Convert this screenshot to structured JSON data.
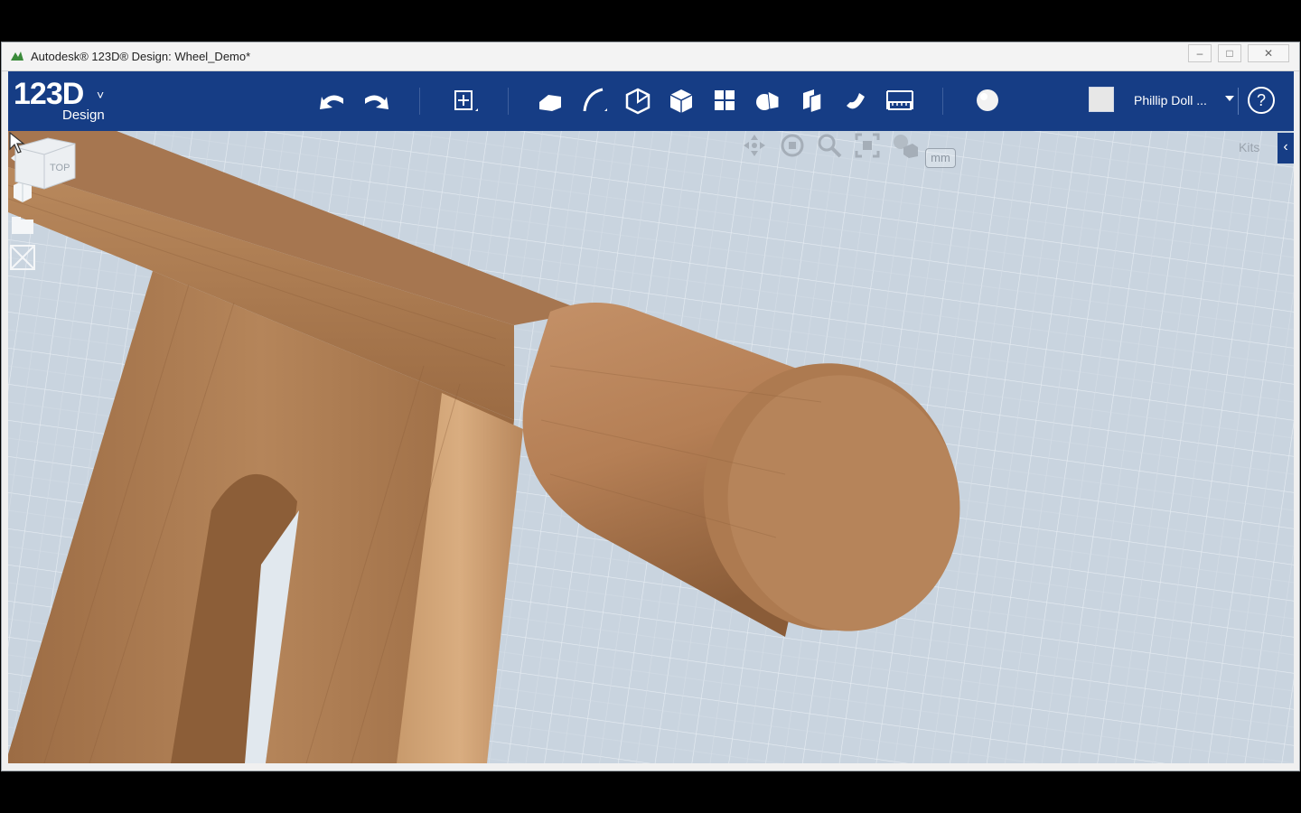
{
  "window": {
    "title": "Autodesk® 123D® Design: Wheel_Demo*",
    "controls": {
      "minimize": "–",
      "maximize": "□",
      "close": "✕"
    }
  },
  "toolbar": {
    "logo_main": "123D",
    "logo_sub": "Design",
    "logo_caret": "˅",
    "tools": [
      {
        "name": "undo-icon"
      },
      {
        "name": "redo-icon"
      },
      {
        "name": "transform-icon"
      },
      {
        "name": "primitives-icon"
      },
      {
        "name": "sketch-icon"
      },
      {
        "name": "construct-icon"
      },
      {
        "name": "modify-icon"
      },
      {
        "name": "pattern-icon"
      },
      {
        "name": "grouping-icon"
      },
      {
        "name": "combine-icon"
      },
      {
        "name": "snap-icon"
      },
      {
        "name": "measure-icon"
      },
      {
        "name": "material-icon"
      }
    ],
    "user": {
      "name": "Phillip Doll ..."
    },
    "help_label": "?"
  },
  "viewport": {
    "kits_label": "Kits",
    "kits_toggle": "‹",
    "units_label": "mm",
    "viewcube_label": "TOP",
    "nav_icons": [
      "pan-icon",
      "orbit-icon",
      "zoom-icon",
      "fit-icon",
      "view-mode-icon"
    ],
    "side_icons": [
      "visibility-icon",
      "solids-icon",
      "sketches-icon",
      "hide-all-icon"
    ]
  },
  "colors": {
    "toolbar_bg": "#163d85",
    "grid_bg": "#c8d3de",
    "wood": "#a8774c"
  }
}
